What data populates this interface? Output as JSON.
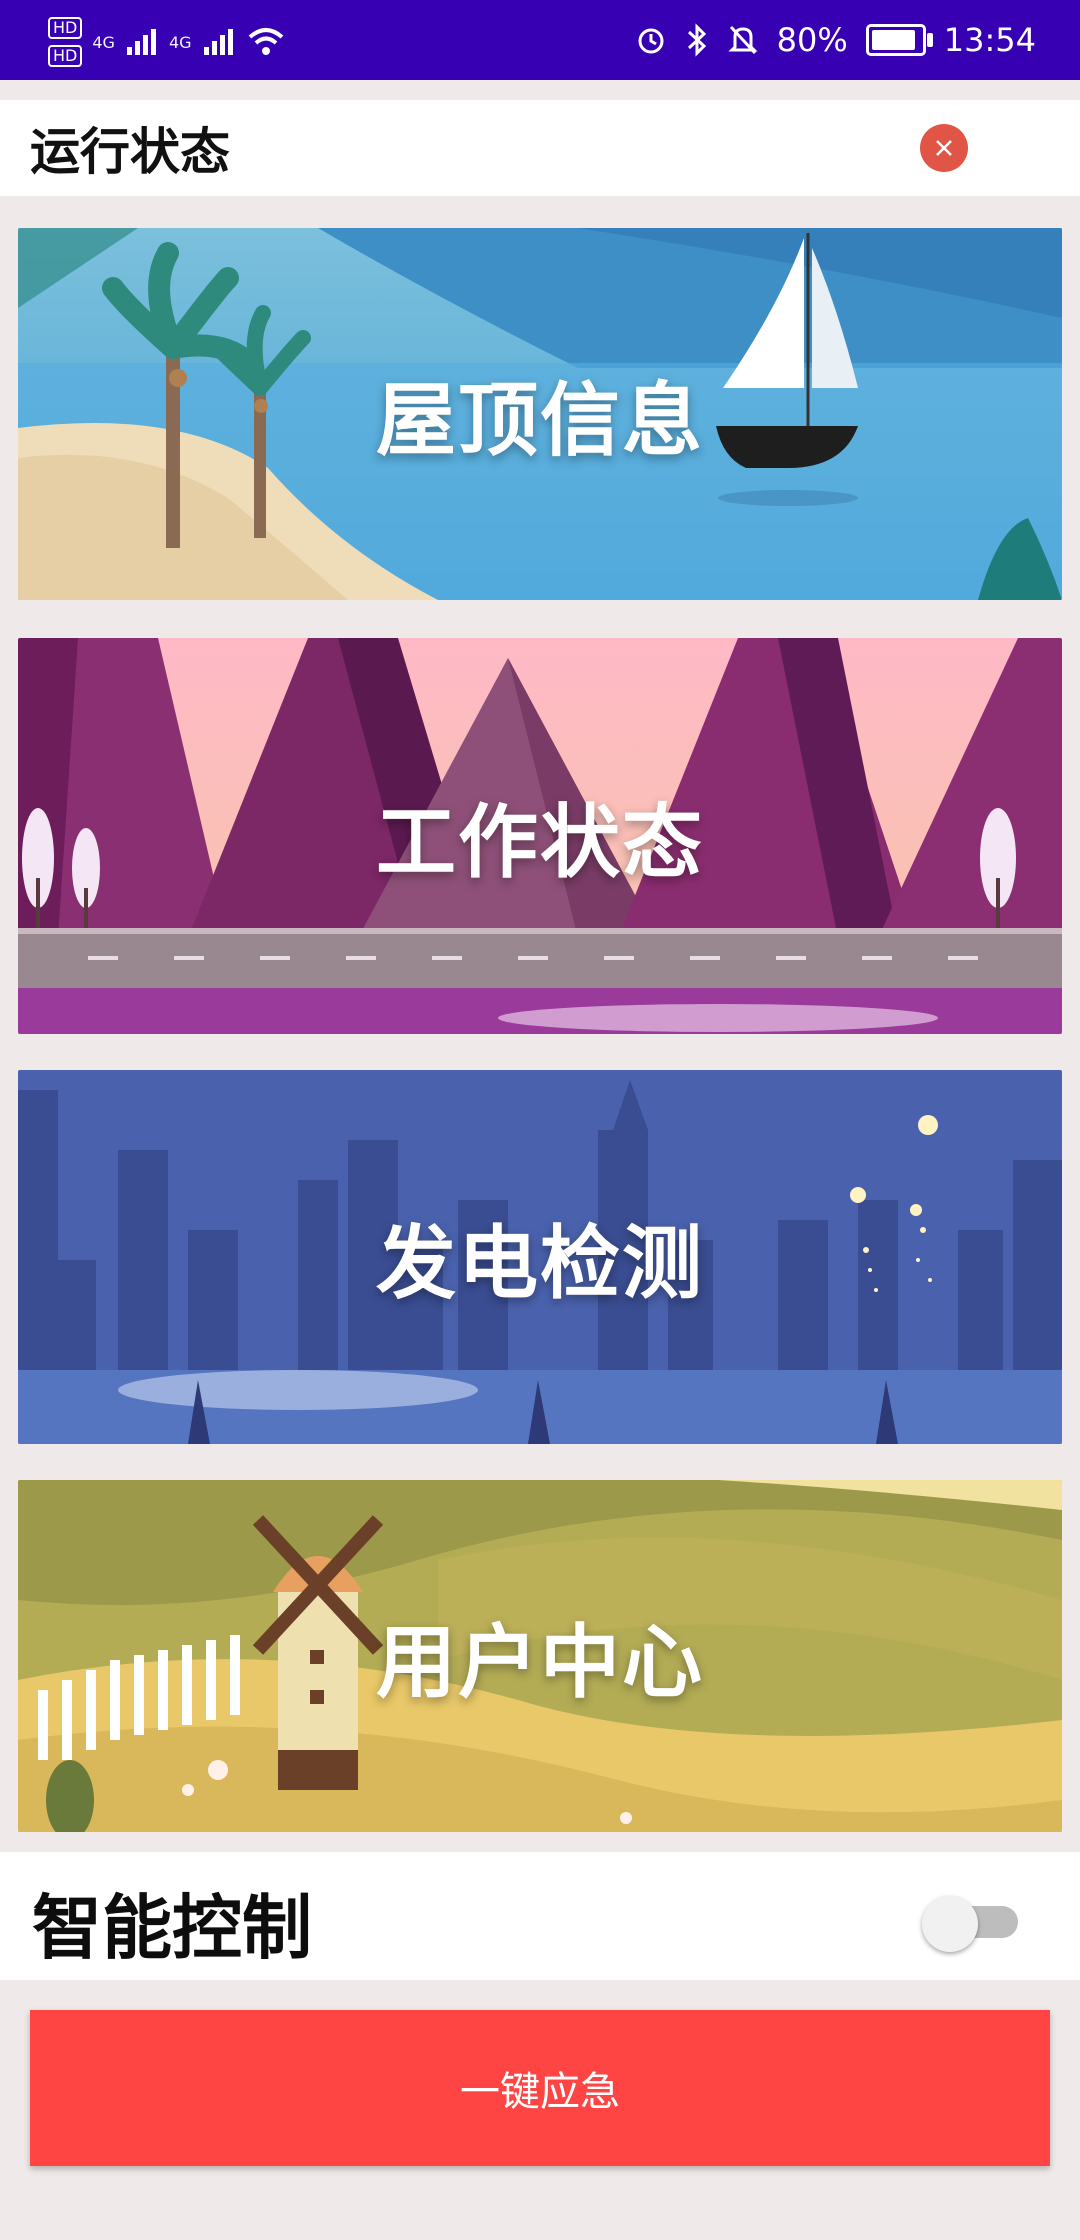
{
  "status_bar": {
    "hd1": "HD",
    "hd2": "HD",
    "net1": "4G",
    "net2": "4G",
    "battery_percent": "80%",
    "time": "13:54",
    "icons": [
      "alarm-icon",
      "bluetooth-icon",
      "mute-icon",
      "wifi-icon",
      "battery-icon"
    ]
  },
  "header": {
    "title": "运行状态",
    "close_icon": "close-icon"
  },
  "cards": [
    {
      "label": "屋顶信息",
      "theme": "beach-sailboat"
    },
    {
      "label": "工作状态",
      "theme": "purple-mountains-road"
    },
    {
      "label": "发电检测",
      "theme": "city-night-fireworks"
    },
    {
      "label": "用户中心",
      "theme": "windmill-hills"
    }
  ],
  "smart_control": {
    "label": "智能控制",
    "toggle_on": false
  },
  "emergency_button": {
    "label": "一键应急",
    "color": "#ff4444"
  },
  "colors": {
    "status_bar": "#3700b3",
    "background": "#efe9e9",
    "close": "#e05545"
  }
}
